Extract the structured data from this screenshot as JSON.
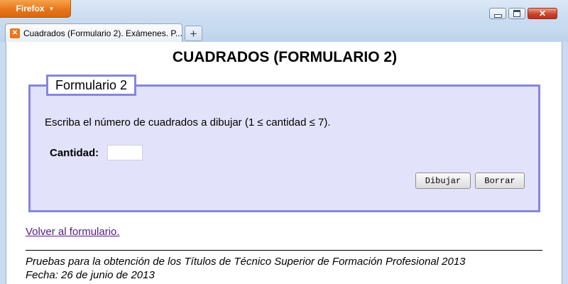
{
  "browser": {
    "menu_button_label": "Firefox",
    "menu_button_arrow": "▼",
    "tab_title": "Cuadrados (Formulario 2). Exámenes. P...",
    "tab_icon_glyph": "✕",
    "new_tab_glyph": "+",
    "close_glyph": "✕",
    "accent_orange": "#e8761b"
  },
  "page": {
    "title": "CUADRADOS (FORMULARIO 2)",
    "legend": "Formulario 2",
    "instructions": "Escriba el número de cuadrados a dibujar (1 ≤ cantidad ≤ 7).",
    "quantity_label": "Cantidad:",
    "quantity_value": "",
    "draw_button": "Dibujar",
    "clear_button": "Borrar",
    "back_link": "Volver al formulario.",
    "footer_line1": "Pruebas para la obtención de los Títulos de Técnico Superior de Formación Profesional 2013",
    "footer_line2": "Fecha: 26 de junio de 2013",
    "fieldset_border_color": "#8686dd",
    "fieldset_bg_color": "#e2e2fa",
    "link_color": "#551a8b"
  }
}
